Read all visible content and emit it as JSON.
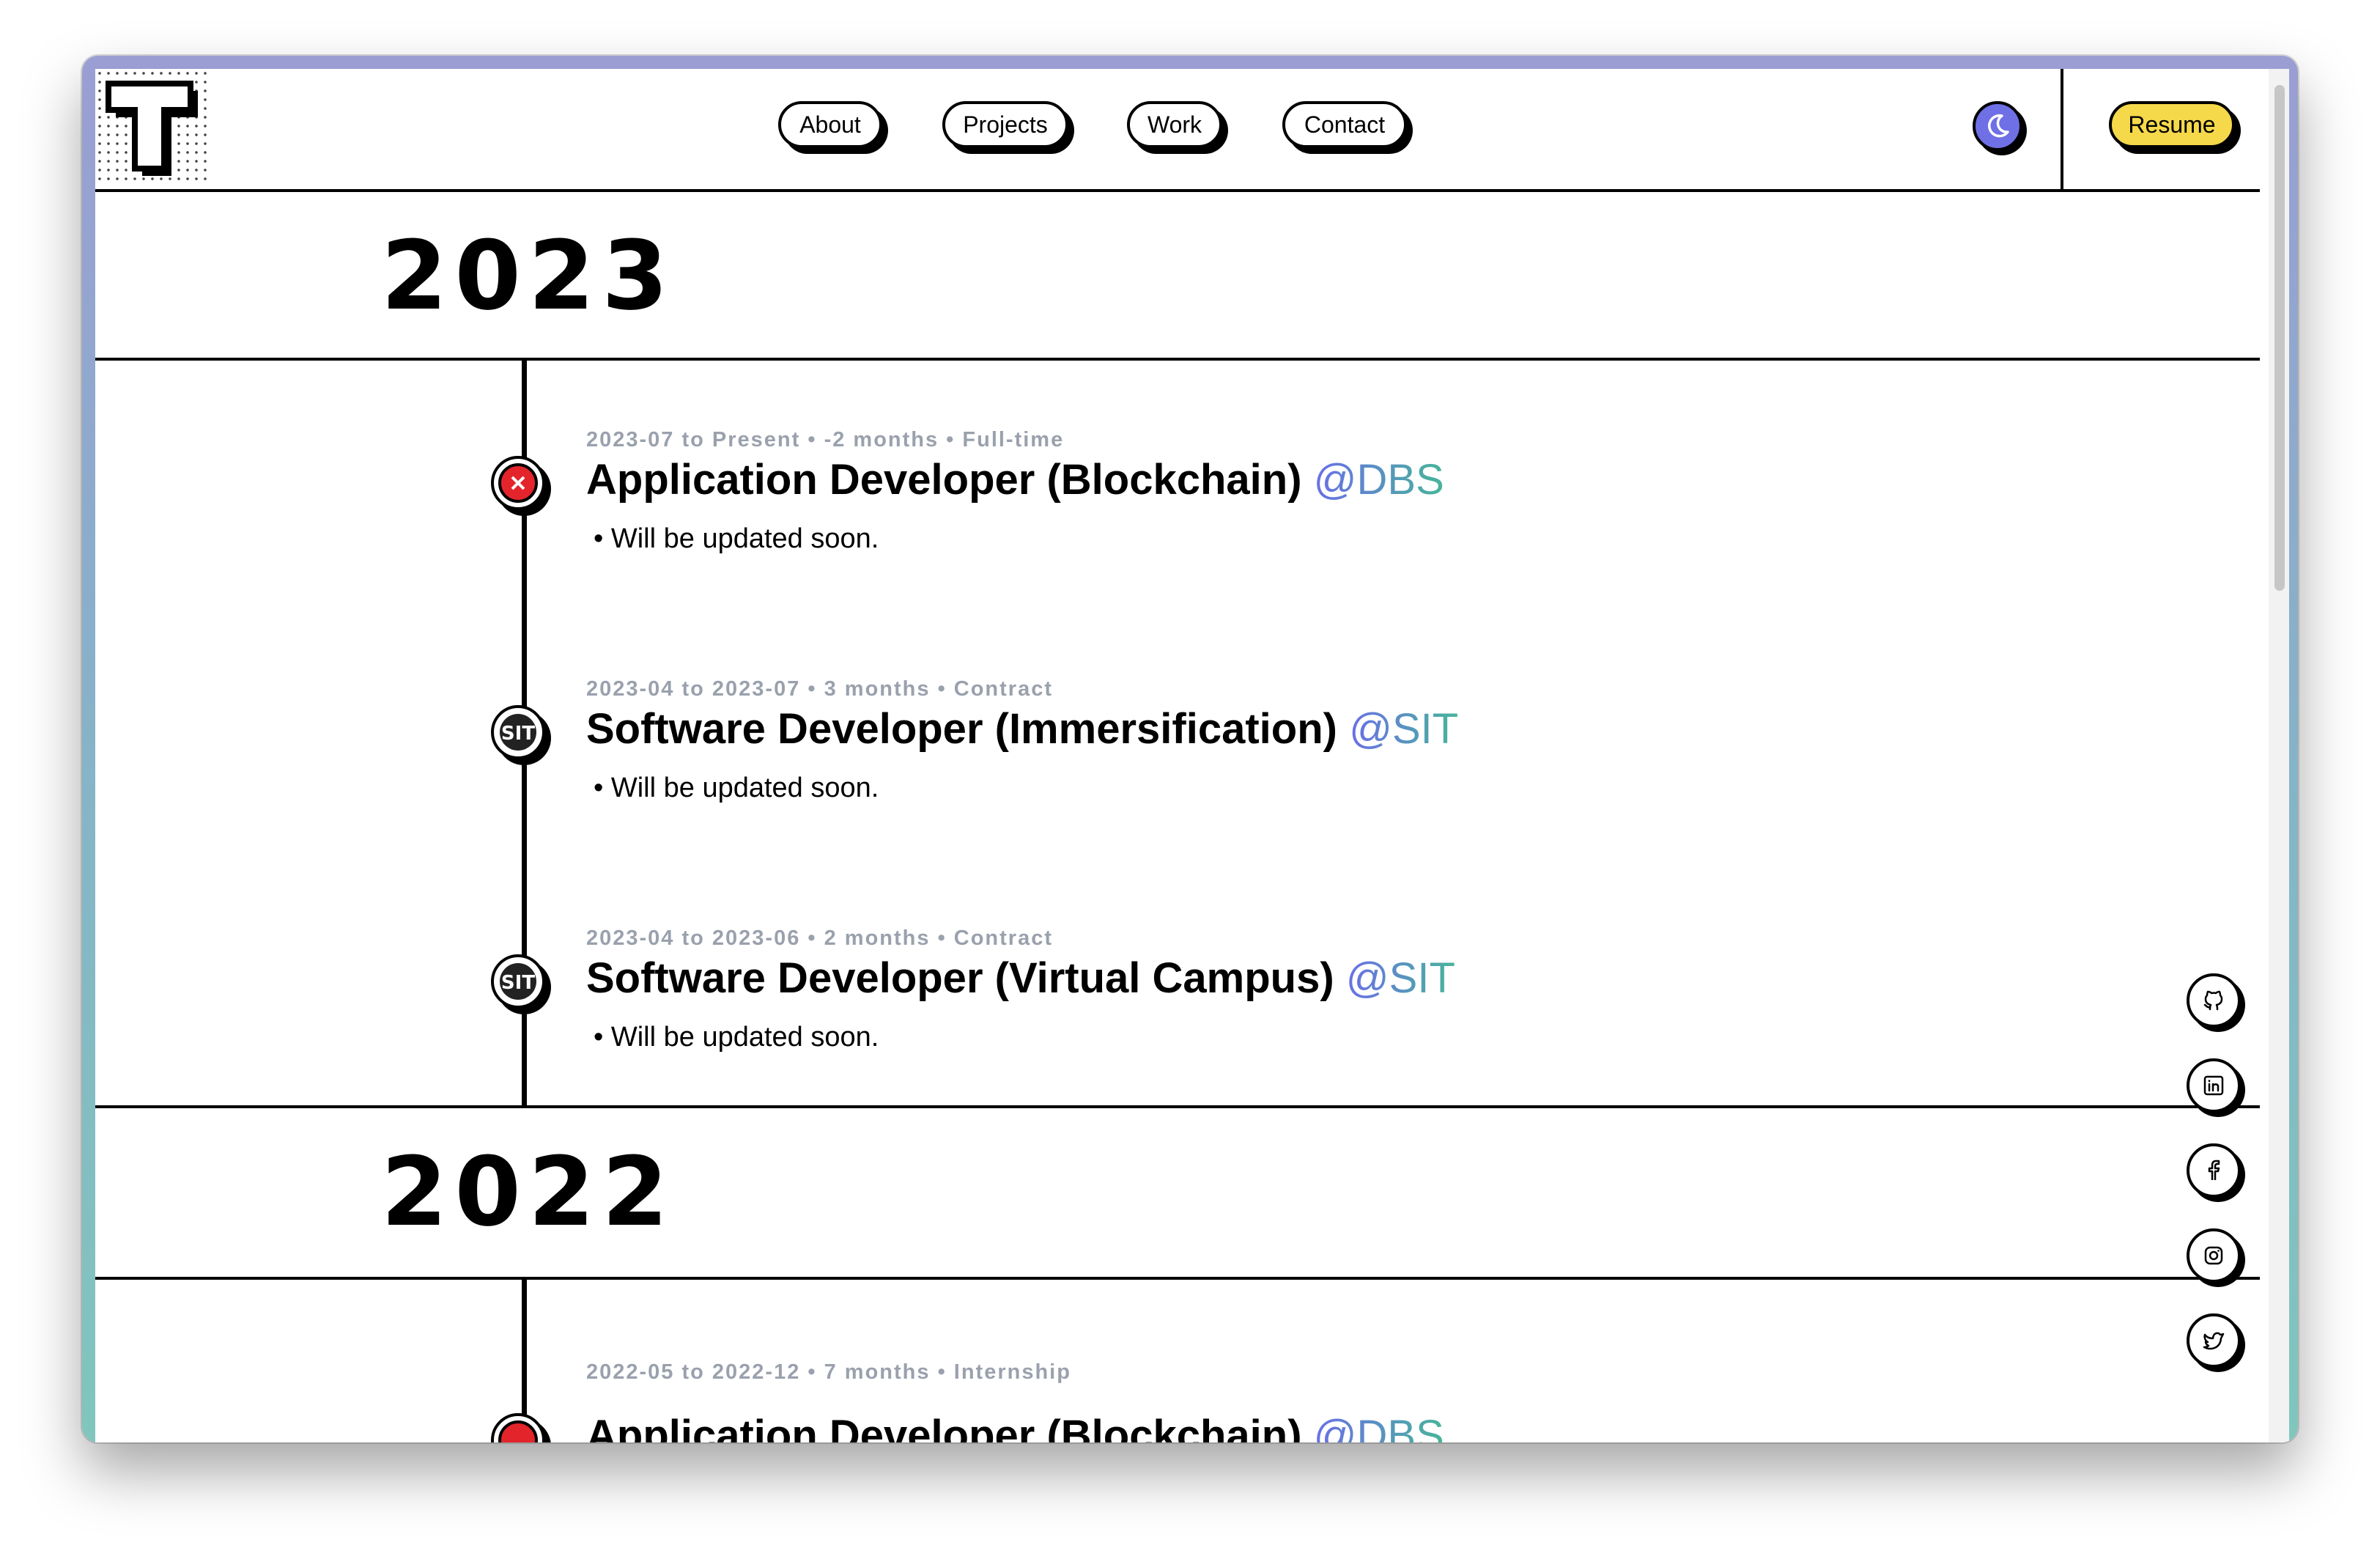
{
  "nav": {
    "logo_letter": "T",
    "links": [
      "About",
      "Projects",
      "Work",
      "Contact"
    ],
    "resume_label": "Resume",
    "theme_icon": "moon-icon"
  },
  "timeline": [
    {
      "year": "2023",
      "entries": [
        {
          "meta": "2023-07 to Present • -2 months • Full-time",
          "title": "Application Developer (Blockchain)",
          "company": "@DBS",
          "logo": "dbs-logo-icon",
          "bullet": "Will be updated soon."
        },
        {
          "meta": "2023-04 to 2023-07 • 3 months • Contract",
          "title": "Software Developer (Immersification)",
          "company": "@SIT",
          "logo": "sit-logo-icon",
          "bullet": "Will be updated soon."
        },
        {
          "meta": "2023-04 to 2023-06 • 2 months • Contract",
          "title": "Software Developer (Virtual Campus)",
          "company": "@SIT",
          "logo": "sit-logo-icon",
          "bullet": "Will be updated soon."
        }
      ]
    },
    {
      "year": "2022",
      "entries": [
        {
          "meta": "2022-05 to 2022-12 • 7 months • Internship",
          "title": "Application Developer (Blockchain)",
          "company": "@DBS",
          "logo": "dbs-logo-icon"
        }
      ]
    }
  ],
  "social_icons": [
    "github-icon",
    "linkedin-icon",
    "facebook-icon",
    "instagram-icon",
    "twitter-icon"
  ],
  "colors": {
    "resume_bg": "#f6d94a",
    "theme_button": "#6f6fe6",
    "company_gradient_start": "#6a6ee8",
    "company_gradient_end": "#47b59a",
    "meta_text": "#9aa1ad",
    "dbs_red": "#e3242b"
  }
}
